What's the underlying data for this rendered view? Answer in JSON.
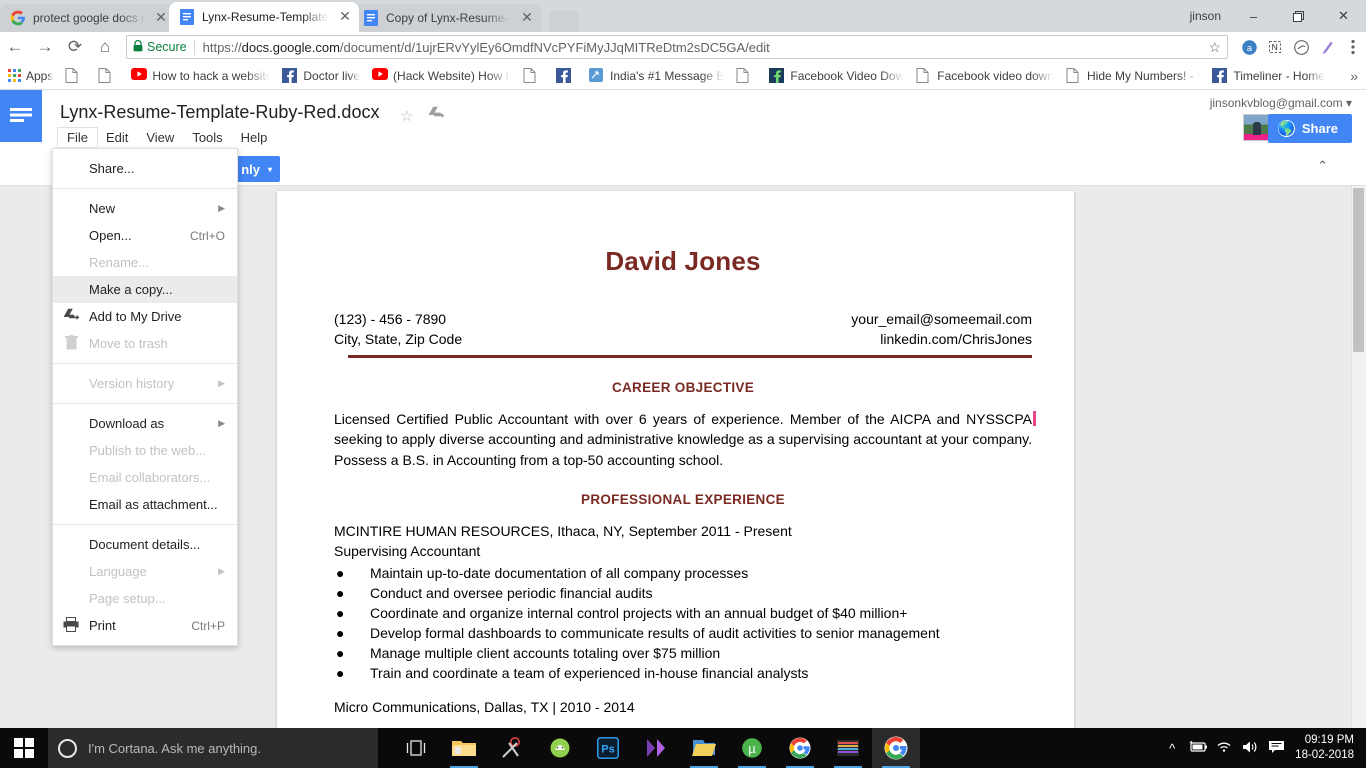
{
  "browser": {
    "window_user": "jinson",
    "tabs": [
      {
        "title": "protect google docs not",
        "favicon": "google-icon",
        "active": false
      },
      {
        "title": "Lynx-Resume-Template-R",
        "favicon": "google-docs-icon",
        "active": true
      },
      {
        "title": "Copy of Lynx-Resume-Te",
        "favicon": "google-docs-icon",
        "active": false
      }
    ],
    "window_controls": {
      "minimize": "–",
      "maximize": "❐",
      "close": "✕"
    },
    "nav": {
      "back": "←",
      "forward": "→",
      "reload": "⟳",
      "home": "⌂"
    },
    "omnibox": {
      "secure_label": "Secure",
      "lock_icon": "lock-icon",
      "url_prefix": "https://",
      "url_domain": "docs.google.com",
      "url_path": "/document/d/1ujrERvYylEy6OmdfNVcPYFiMyJJqMITReDtm2sDC5GA/edit",
      "star_icon": "star-icon"
    },
    "extensions": [
      "adblock-icon",
      "notes-icon",
      "shazam-icon",
      "pen-icon",
      "chrome-menu-icon"
    ],
    "bookmarks": {
      "apps_label": "Apps",
      "items": [
        {
          "label": "",
          "icon": "page-icon"
        },
        {
          "label": "",
          "icon": "page-icon"
        },
        {
          "label": "How to hack a website",
          "icon": "youtube-icon"
        },
        {
          "label": "Doctor live",
          "icon": "facebook-icon"
        },
        {
          "label": "(Hack Website) How to",
          "icon": "youtube-icon"
        },
        {
          "label": "India's #1 Message B",
          "icon": "facebook-icon"
        },
        {
          "label": "",
          "icon": "app-icon"
        },
        {
          "label": "",
          "icon": "page-icon"
        },
        {
          "label": "Facebook Video Dow",
          "icon": "facebook-dark-icon"
        },
        {
          "label": "Facebook video down",
          "icon": "page-icon"
        },
        {
          "label": "Hide My Numbers! - I",
          "icon": "page-icon"
        },
        {
          "label": "Timeliner - Home",
          "icon": "facebook-icon"
        }
      ],
      "overflow": "»"
    }
  },
  "docs": {
    "hamburger_icon": "docs-menu-icon",
    "title": "Lynx-Resume-Template-Ruby-Red.docx",
    "star_icon": "star-outline-icon",
    "drive_icon": "drive-move-icon",
    "menus": [
      "File",
      "Edit",
      "View",
      "Tools",
      "Help"
    ],
    "open_menu": "File",
    "account_email": "jinsonkvblog@gmail.com",
    "account_caret": "▾",
    "avatar": "user-avatar",
    "share_label": "Share",
    "share_icon": "globe-icon",
    "view_mode_label": "nly",
    "view_mode_caret": "▾",
    "collapse_caret": "⌃",
    "accent_blue": "#4285f4"
  },
  "file_menu": {
    "groups": [
      [
        {
          "label": "Share...",
          "icon": null,
          "accel": null,
          "arrow": false,
          "disabled": false,
          "highlight": false
        }
      ],
      [
        {
          "label": "New",
          "icon": null,
          "accel": null,
          "arrow": true,
          "disabled": false,
          "highlight": false
        },
        {
          "label": "Open...",
          "icon": null,
          "accel": "Ctrl+O",
          "arrow": false,
          "disabled": false,
          "highlight": false
        },
        {
          "label": "Rename...",
          "icon": null,
          "accel": null,
          "arrow": false,
          "disabled": true,
          "highlight": false
        },
        {
          "label": "Make a copy...",
          "icon": null,
          "accel": null,
          "arrow": false,
          "disabled": false,
          "highlight": true
        },
        {
          "label": "Add to My Drive",
          "icon": "drive-add-icon",
          "accel": null,
          "arrow": false,
          "disabled": false,
          "highlight": false
        },
        {
          "label": "Move to trash",
          "icon": "trash-icon",
          "accel": null,
          "arrow": false,
          "disabled": true,
          "highlight": false
        }
      ],
      [
        {
          "label": "Version history",
          "icon": null,
          "accel": null,
          "arrow": true,
          "disabled": true,
          "highlight": false
        }
      ],
      [
        {
          "label": "Download as",
          "icon": null,
          "accel": null,
          "arrow": true,
          "disabled": false,
          "highlight": false
        },
        {
          "label": "Publish to the web...",
          "icon": null,
          "accel": null,
          "arrow": false,
          "disabled": true,
          "highlight": false
        },
        {
          "label": "Email collaborators...",
          "icon": null,
          "accel": null,
          "arrow": false,
          "disabled": true,
          "highlight": false
        },
        {
          "label": "Email as attachment...",
          "icon": null,
          "accel": null,
          "arrow": false,
          "disabled": false,
          "highlight": false
        }
      ],
      [
        {
          "label": "Document details...",
          "icon": null,
          "accel": null,
          "arrow": false,
          "disabled": false,
          "highlight": false
        },
        {
          "label": "Language",
          "icon": null,
          "accel": null,
          "arrow": true,
          "disabled": true,
          "highlight": false
        },
        {
          "label": "Page setup...",
          "icon": null,
          "accel": null,
          "arrow": false,
          "disabled": true,
          "highlight": false
        },
        {
          "label": "Print",
          "icon": "printer-icon",
          "accel": "Ctrl+P",
          "arrow": false,
          "disabled": false,
          "highlight": false
        }
      ]
    ]
  },
  "document": {
    "accent_color": "#7b2a23",
    "name": "David Jones",
    "contact_left": [
      "(123) - 456 - 7890",
      "City, State, Zip Code"
    ],
    "contact_right": [
      "your_email@someemail.com",
      "linkedin.com/ChrisJones"
    ],
    "sections": {
      "objective_heading": "CAREER OBJECTIVE",
      "objective_text": "Licensed Certified Public Accountant with over 6 years of experience. Member of the AICPA and NYSSCPA seeking to apply diverse accounting and administrative knowledge as a supervising accountant at your company. Possess a B.S. in Accounting from a top-50 accounting school.",
      "experience_heading": "PROFESSIONAL EXPERIENCE",
      "job1_company": "MCINTIRE HUMAN RESOURCES, Ithaca, NY, September 2011 - Present",
      "job1_title": "Supervising Accountant",
      "job1_bullets": [
        "Maintain up-to-date documentation of all company processes",
        "Conduct and oversee periodic financial audits",
        "Coordinate and organize internal control projects with an annual budget of $40 million+",
        "Develop formal dashboards to communicate results of audit activities to senior management",
        "Manage multiple client accounts totaling over $75 million",
        "Train and coordinate a team of experienced in-house financial analysts"
      ],
      "job2_company": "Micro Communications, Dallas, TX | 2010 - 2014"
    }
  },
  "taskbar": {
    "start_icon": "windows-start-icon",
    "cortana_placeholder": "I'm Cortana. Ask me anything.",
    "cortana_icon": "cortana-ring-icon",
    "items": [
      {
        "name": "task-view-icon",
        "active": false,
        "running": false
      },
      {
        "name": "file-explorer-icon",
        "active": false,
        "running": true
      },
      {
        "name": "snipping-tool-icon",
        "active": false,
        "running": false
      },
      {
        "name": "android-studio-icon",
        "active": false,
        "running": false
      },
      {
        "name": "photoshop-icon",
        "active": false,
        "running": false
      },
      {
        "name": "movie-maker-icon",
        "active": false,
        "running": false
      },
      {
        "name": "folder-icon",
        "active": false,
        "running": true
      },
      {
        "name": "utorrent-icon",
        "active": false,
        "running": true
      },
      {
        "name": "chrome-icon",
        "active": false,
        "running": true
      },
      {
        "name": "winrar-icon",
        "active": false,
        "running": true
      },
      {
        "name": "chrome-active-icon",
        "active": true,
        "running": true
      }
    ],
    "tray": [
      "show-hidden-icons",
      "battery-icon",
      "wifi-icon",
      "volume-icon",
      "action-center-icon"
    ],
    "time": "09:19 PM",
    "date": "18-02-2018"
  }
}
